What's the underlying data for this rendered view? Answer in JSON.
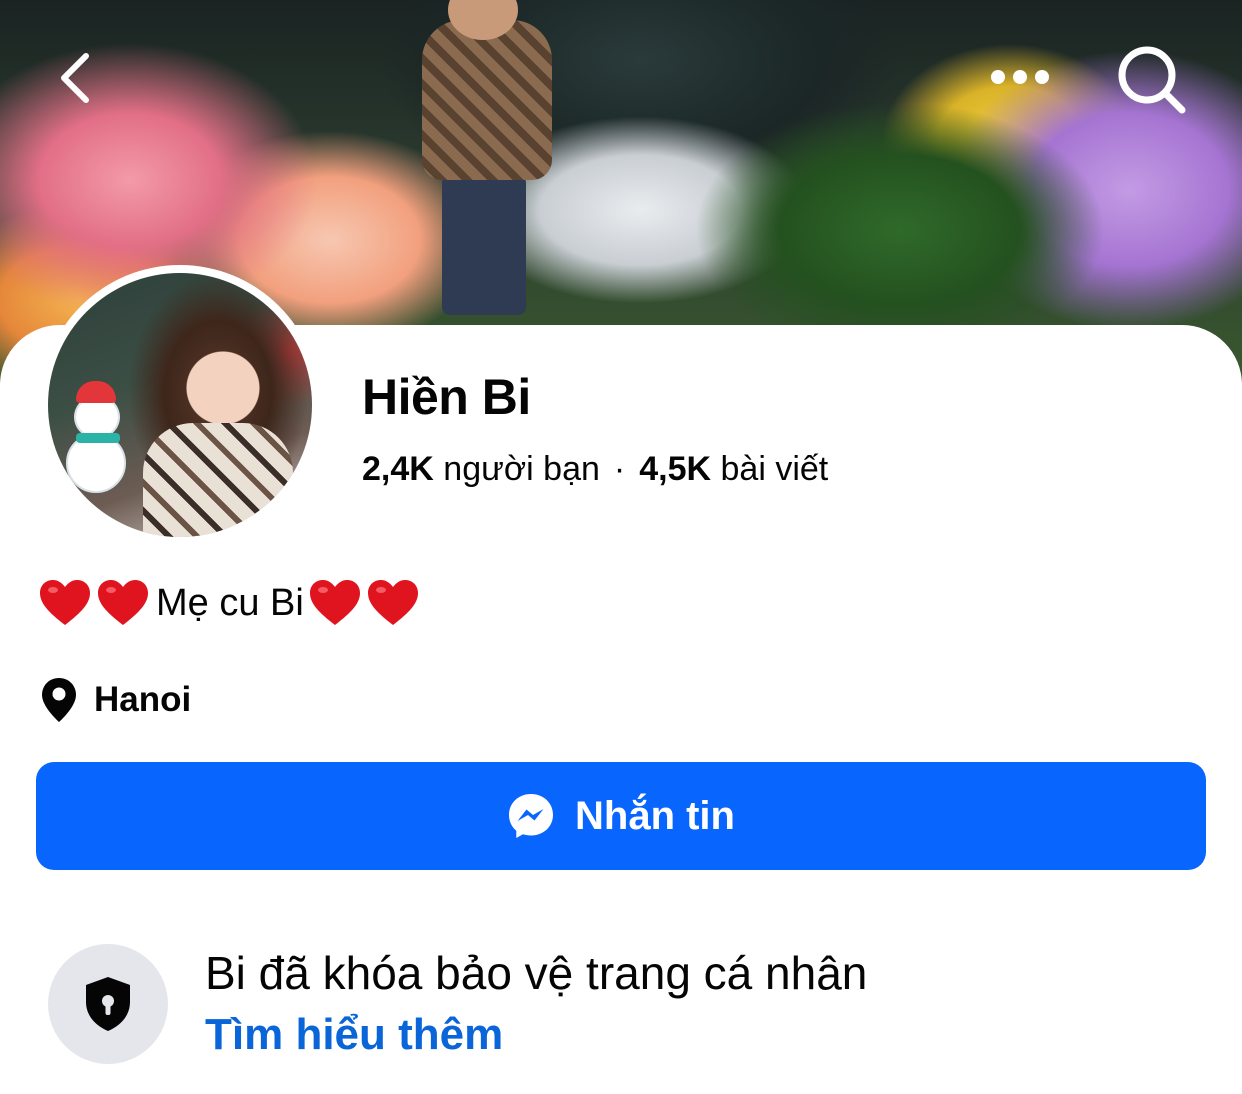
{
  "cover": {
    "back_icon": "chevron-left-icon",
    "more_icon": "more-horizontal-icon",
    "search_icon": "search-icon"
  },
  "profile": {
    "name": "Hiền Bi",
    "friends_count": "2,4K",
    "friends_label": "người bạn",
    "separator": "·",
    "posts_count": "4,5K",
    "posts_label": "bài viết"
  },
  "bio": {
    "text": "Mẹ cu Bi",
    "emoji_icon": "red-heart-icon"
  },
  "location": {
    "icon": "location-pin-icon",
    "text": "Hanoi"
  },
  "actions": {
    "message_label": "Nhắn tin",
    "message_icon": "messenger-icon"
  },
  "privacy": {
    "icon": "shield-lock-icon",
    "title": "Bi đã khóa bảo vệ trang cá nhân",
    "learn_more": "Tìm hiểu thêm"
  },
  "colors": {
    "primary_button": "#0866ff",
    "link": "#0a66d8",
    "icon_bg": "#e4e6eb",
    "heart": "#e0141e"
  }
}
